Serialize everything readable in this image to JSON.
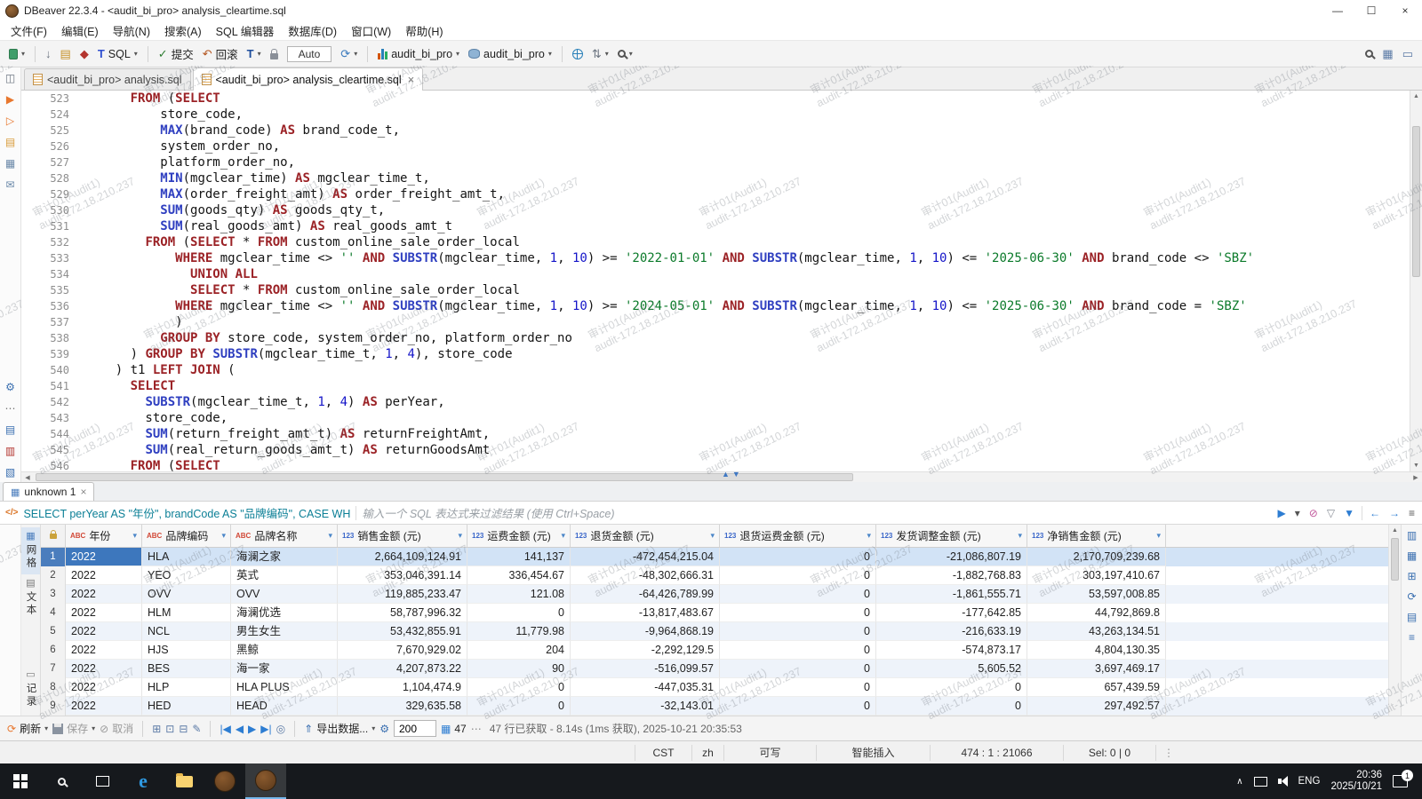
{
  "titlebar": {
    "title": "DBeaver 22.3.4 - <audit_bi_pro> analysis_cleartime.sql",
    "minimize": "—",
    "maximize": "☐",
    "close": "×"
  },
  "menu": [
    "文件(F)",
    "编辑(E)",
    "导航(N)",
    "搜索(A)",
    "SQL 编辑器",
    "数据库(D)",
    "窗口(W)",
    "帮助(H)"
  ],
  "toolbar": {
    "sql_label": "SQL",
    "commit_label": "提交",
    "rollback_label": "回滚",
    "txn_letter": "T",
    "auto_label": "Auto",
    "datasource": "audit_bi_pro",
    "schema": "audit_bi_pro"
  },
  "editor_tabs": [
    {
      "label": "<audit_bi_pro> analysis.sql",
      "active": false
    },
    {
      "label": "<audit_bi_pro> analysis_cleartime.sql",
      "active": true
    }
  ],
  "editor": {
    "lines": [
      {
        "n": 523,
        "s": [
          [
            "p",
            "      "
          ],
          [
            "k",
            "FROM"
          ],
          [
            "p",
            " ("
          ],
          [
            "k",
            "SELECT"
          ]
        ]
      },
      {
        "n": 524,
        "s": [
          [
            "p",
            "          store_code,"
          ]
        ]
      },
      {
        "n": 525,
        "s": [
          [
            "p",
            "          "
          ],
          [
            "f",
            "MAX"
          ],
          [
            "p",
            "(brand_code) "
          ],
          [
            "k",
            "AS"
          ],
          [
            "p",
            " brand_code_t,"
          ]
        ]
      },
      {
        "n": 526,
        "s": [
          [
            "p",
            "          system_order_no,"
          ]
        ]
      },
      {
        "n": 527,
        "s": [
          [
            "p",
            "          platform_order_no,"
          ]
        ]
      },
      {
        "n": 528,
        "s": [
          [
            "p",
            "          "
          ],
          [
            "f",
            "MIN"
          ],
          [
            "p",
            "(mgclear_time) "
          ],
          [
            "k",
            "AS"
          ],
          [
            "p",
            " mgclear_time_t,"
          ]
        ]
      },
      {
        "n": 529,
        "s": [
          [
            "p",
            "          "
          ],
          [
            "f",
            "MAX"
          ],
          [
            "p",
            "(order_freight_amt) "
          ],
          [
            "k",
            "AS"
          ],
          [
            "p",
            " order_freight_amt_t,"
          ]
        ]
      },
      {
        "n": 530,
        "s": [
          [
            "p",
            "          "
          ],
          [
            "f",
            "SUM"
          ],
          [
            "p",
            "(goods_qty) "
          ],
          [
            "k",
            "AS"
          ],
          [
            "p",
            " goods_qty_t,"
          ]
        ]
      },
      {
        "n": 531,
        "s": [
          [
            "p",
            "          "
          ],
          [
            "f",
            "SUM"
          ],
          [
            "p",
            "(real_goods_amt) "
          ],
          [
            "k",
            "AS"
          ],
          [
            "p",
            " real_goods_amt_t"
          ]
        ]
      },
      {
        "n": 532,
        "s": [
          [
            "p",
            "        "
          ],
          [
            "k",
            "FROM"
          ],
          [
            "p",
            " ("
          ],
          [
            "k",
            "SELECT"
          ],
          [
            "p",
            " * "
          ],
          [
            "k",
            "FROM"
          ],
          [
            "p",
            " custom_online_sale_order_local"
          ]
        ]
      },
      {
        "n": 533,
        "s": [
          [
            "p",
            "            "
          ],
          [
            "k",
            "WHERE"
          ],
          [
            "p",
            " mgclear_time <> "
          ],
          [
            "s",
            "''"
          ],
          [
            "p",
            " "
          ],
          [
            "k",
            "AND"
          ],
          [
            "p",
            " "
          ],
          [
            "f",
            "SUBSTR"
          ],
          [
            "p",
            "(mgclear_time, "
          ],
          [
            "n",
            "1"
          ],
          [
            "p",
            ", "
          ],
          [
            "n",
            "10"
          ],
          [
            "p",
            ") >= "
          ],
          [
            "s",
            "'2022-01-01'"
          ],
          [
            "p",
            " "
          ],
          [
            "k",
            "AND"
          ],
          [
            "p",
            " "
          ],
          [
            "f",
            "SUBSTR"
          ],
          [
            "p",
            "(mgclear_time, "
          ],
          [
            "n",
            "1"
          ],
          [
            "p",
            ", "
          ],
          [
            "n",
            "10"
          ],
          [
            "p",
            ") <= "
          ],
          [
            "s",
            "'2025-06-30'"
          ],
          [
            "p",
            " "
          ],
          [
            "k",
            "AND"
          ],
          [
            "p",
            " brand_code <> "
          ],
          [
            "s",
            "'SBZ'"
          ]
        ]
      },
      {
        "n": 534,
        "s": [
          [
            "p",
            "              "
          ],
          [
            "k",
            "UNION ALL"
          ]
        ]
      },
      {
        "n": 535,
        "s": [
          [
            "p",
            "              "
          ],
          [
            "k",
            "SELECT"
          ],
          [
            "p",
            " * "
          ],
          [
            "k",
            "FROM"
          ],
          [
            "p",
            " custom_online_sale_order_local"
          ]
        ]
      },
      {
        "n": 536,
        "s": [
          [
            "p",
            "            "
          ],
          [
            "k",
            "WHERE"
          ],
          [
            "p",
            " mgclear_time <> "
          ],
          [
            "s",
            "''"
          ],
          [
            "p",
            " "
          ],
          [
            "k",
            "AND"
          ],
          [
            "p",
            " "
          ],
          [
            "f",
            "SUBSTR"
          ],
          [
            "p",
            "(mgclear_time, "
          ],
          [
            "n",
            "1"
          ],
          [
            "p",
            ", "
          ],
          [
            "n",
            "10"
          ],
          [
            "p",
            ") >= "
          ],
          [
            "s",
            "'2024-05-01'"
          ],
          [
            "p",
            " "
          ],
          [
            "k",
            "AND"
          ],
          [
            "p",
            " "
          ],
          [
            "f",
            "SUBSTR"
          ],
          [
            "p",
            "(mgclear_time, "
          ],
          [
            "n",
            "1"
          ],
          [
            "p",
            ", "
          ],
          [
            "n",
            "10"
          ],
          [
            "p",
            ") <= "
          ],
          [
            "s",
            "'2025-06-30'"
          ],
          [
            "p",
            " "
          ],
          [
            "k",
            "AND"
          ],
          [
            "p",
            " brand_code = "
          ],
          [
            "s",
            "'SBZ'"
          ]
        ]
      },
      {
        "n": 537,
        "s": [
          [
            "p",
            "            )"
          ]
        ]
      },
      {
        "n": 538,
        "s": [
          [
            "p",
            "          "
          ],
          [
            "k",
            "GROUP BY"
          ],
          [
            "p",
            " store_code, system_order_no, platform_order_no"
          ]
        ]
      },
      {
        "n": 539,
        "s": [
          [
            "p",
            "      ) "
          ],
          [
            "k",
            "GROUP BY"
          ],
          [
            "p",
            " "
          ],
          [
            "f",
            "SUBSTR"
          ],
          [
            "p",
            "(mgclear_time_t, "
          ],
          [
            "n",
            "1"
          ],
          [
            "p",
            ", "
          ],
          [
            "n",
            "4"
          ],
          [
            "p",
            "), store_code"
          ]
        ]
      },
      {
        "n": 540,
        "s": [
          [
            "p",
            "    ) t1 "
          ],
          [
            "k",
            "LEFT JOIN"
          ],
          [
            "p",
            " ("
          ]
        ]
      },
      {
        "n": 541,
        "s": [
          [
            "p",
            "      "
          ],
          [
            "k",
            "SELECT"
          ]
        ]
      },
      {
        "n": 542,
        "s": [
          [
            "p",
            "        "
          ],
          [
            "f",
            "SUBSTR"
          ],
          [
            "p",
            "(mgclear_time_t, "
          ],
          [
            "n",
            "1"
          ],
          [
            "p",
            ", "
          ],
          [
            "n",
            "4"
          ],
          [
            "p",
            ") "
          ],
          [
            "k",
            "AS"
          ],
          [
            "p",
            " perYear,"
          ]
        ]
      },
      {
        "n": 543,
        "s": [
          [
            "p",
            "        store_code,"
          ]
        ]
      },
      {
        "n": 544,
        "s": [
          [
            "p",
            "        "
          ],
          [
            "f",
            "SUM"
          ],
          [
            "p",
            "(return_freight_amt_t) "
          ],
          [
            "k",
            "AS"
          ],
          [
            "p",
            " returnFreightAmt,"
          ]
        ]
      },
      {
        "n": 545,
        "s": [
          [
            "p",
            "        "
          ],
          [
            "f",
            "SUM"
          ],
          [
            "p",
            "(real_return_goods_amt_t) "
          ],
          [
            "k",
            "AS"
          ],
          [
            "p",
            " returnGoodsAmt"
          ]
        ]
      },
      {
        "n": 546,
        "s": [
          [
            "p",
            "      "
          ],
          [
            "k",
            "FROM"
          ],
          [
            "p",
            " ("
          ],
          [
            "k",
            "SELECT"
          ]
        ]
      }
    ]
  },
  "watermark": {
    "line1": "审计01(Audit1)",
    "line2": "audit-172.18.210.237"
  },
  "results": {
    "tab_label": "unknown 1",
    "filter_sql": "SELECT perYear AS \"年份\", brandCode AS \"品牌编码\", CASE WH",
    "filter_placeholder": "输入一个 SQL 表达式来过滤结果 (使用 Ctrl+Space)",
    "side_tabs": [
      "网格",
      "文本"
    ],
    "side_bottom": "记录",
    "columns": [
      {
        "type": "ABC",
        "label": "年份"
      },
      {
        "type": "ABC",
        "label": "品牌编码"
      },
      {
        "type": "ABC",
        "label": "品牌名称"
      },
      {
        "type": "123",
        "label": "销售金额 (元)"
      },
      {
        "type": "123",
        "label": "运费金额 (元)"
      },
      {
        "type": "123",
        "label": "退货金额 (元)"
      },
      {
        "type": "123",
        "label": "退货运费金额 (元)"
      },
      {
        "type": "123",
        "label": "发货调整金额 (元)"
      },
      {
        "type": "123",
        "label": "净销售金额 (元)"
      }
    ],
    "rows": [
      [
        "2022",
        "HLA",
        "海澜之家",
        "2,664,109,124.91",
        "141,137",
        "-472,454,215.04",
        "0",
        "-21,086,807.19",
        "2,170,709,239.68"
      ],
      [
        "2022",
        "YEO",
        "英式",
        "353,046,391.14",
        "336,454.67",
        "-48,302,666.31",
        "0",
        "-1,882,768.83",
        "303,197,410.67"
      ],
      [
        "2022",
        "OVV",
        "OVV",
        "119,885,233.47",
        "121.08",
        "-64,426,789.99",
        "0",
        "-1,861,555.71",
        "53,597,008.85"
      ],
      [
        "2022",
        "HLM",
        "海澜优选",
        "58,787,996.32",
        "0",
        "-13,817,483.67",
        "0",
        "-177,642.85",
        "44,792,869.8"
      ],
      [
        "2022",
        "NCL",
        "男生女生",
        "53,432,855.91",
        "11,779.98",
        "-9,964,868.19",
        "0",
        "-216,633.19",
        "43,263,134.51"
      ],
      [
        "2022",
        "HJS",
        "黑鲸",
        "7,670,929.02",
        "204",
        "-2,292,129.5",
        "0",
        "-574,873.17",
        "4,804,130.35"
      ],
      [
        "2022",
        "BES",
        "海一家",
        "4,207,873.22",
        "90",
        "-516,099.57",
        "0",
        "5,605.52",
        "3,697,469.17"
      ],
      [
        "2022",
        "HLP",
        "HLA PLUS",
        "1,104,474.9",
        "0",
        "-447,035.31",
        "0",
        "0",
        "657,439.59"
      ],
      [
        "2022",
        "HED",
        "HEAD",
        "329,635.58",
        "0",
        "-32,143.01",
        "0",
        "0",
        "297,492.57"
      ]
    ],
    "toolbar": {
      "refresh": "刷新",
      "save": "保存",
      "cancel": "取消",
      "export": "导出数据...",
      "fetch_size": "200",
      "row_count": "47",
      "more": "⋯",
      "status": "47 行已获取 - 8.14s (1ms 获取), 2025-10-21 20:35:53"
    }
  },
  "statusbar": [
    "CST",
    "zh",
    "可写",
    "智能插入",
    "474 : 1 : 21066",
    "Sel: 0 | 0"
  ],
  "taskbar": {
    "lang": "ENG",
    "time": "20:36",
    "date": "2025/10/21",
    "badge": "1"
  }
}
